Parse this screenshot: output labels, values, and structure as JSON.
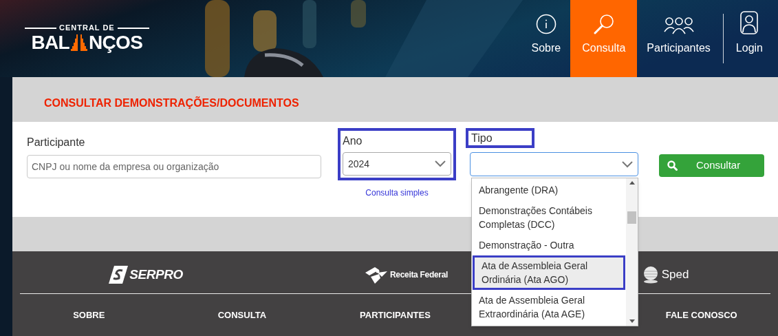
{
  "logo": {
    "top": "CENTRAL DE",
    "left": "BAL",
    "right": "NÇOS"
  },
  "nav": [
    {
      "label": "Sobre",
      "kind": "info",
      "selected": false
    },
    {
      "label": "Consulta",
      "kind": "search",
      "selected": true
    },
    {
      "label": "Participantes",
      "kind": "people",
      "selected": false
    },
    {
      "label": "Login",
      "kind": "user",
      "selected": false
    }
  ],
  "section_title": "CONSULTAR DEMONSTRAÇÕES/DOCUMENTOS",
  "form": {
    "participante": {
      "label": "Participante",
      "placeholder": "CNPJ ou nome da empresa ou organização"
    },
    "ano": {
      "label": "Ano",
      "value": "2024"
    },
    "consulta_simples": "Consulta simples",
    "tipo": {
      "label": "Tipo",
      "options": [
        {
          "label": "Abrangente (DRA)",
          "selected": false
        },
        {
          "label": "Demonstrações Contábeis Completas (DCC)",
          "selected": false
        },
        {
          "label": "Demonstração - Outra",
          "selected": false
        },
        {
          "label": "Ata de Assembleia Geral Ordinária (Ata AGO)",
          "selected": true
        },
        {
          "label": "Ata de Assembleia Geral Extraordinária (Ata AGE)",
          "selected": false
        }
      ]
    },
    "button": "Consultar"
  },
  "footer": {
    "logos": [
      {
        "kind": "serpro",
        "label": "SERPRO"
      },
      {
        "kind": "receita",
        "label": "Receita Federal"
      },
      {
        "kind": "sped",
        "label": "Sped"
      }
    ],
    "links": [
      "SOBRE",
      "CONSULTA",
      "PARTICIPANTES",
      "FALE CONOSCO"
    ]
  }
}
